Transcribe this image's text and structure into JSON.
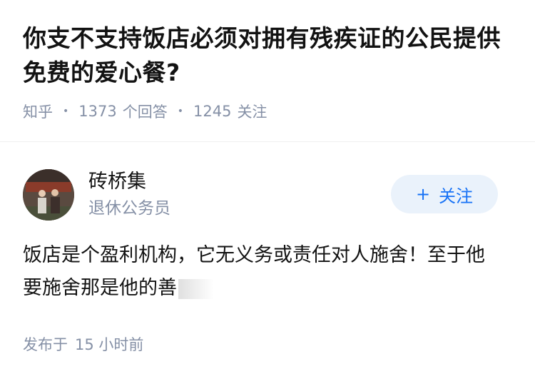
{
  "question": {
    "title": "你支不支持饭店必须对拥有残疾证的公民提供免费的爱心餐?",
    "source": "知乎",
    "answer_count": "1373",
    "answer_label": "个回答",
    "follow_count": "1245",
    "follow_label": "关注"
  },
  "answer": {
    "author_name": "砖桥集",
    "author_bio": "退休公务员",
    "follow_button_label": "关注",
    "content": "饭店是个盈利机构，它无义务或责任对人施舍！至于他要施舍那是他的善",
    "posted_prefix": "发布于",
    "posted_time": "15 小时前"
  },
  "colors": {
    "text_primary": "#121212",
    "text_secondary": "#8590a6",
    "accent": "#1772f6",
    "button_bg": "#eaf2fb"
  }
}
